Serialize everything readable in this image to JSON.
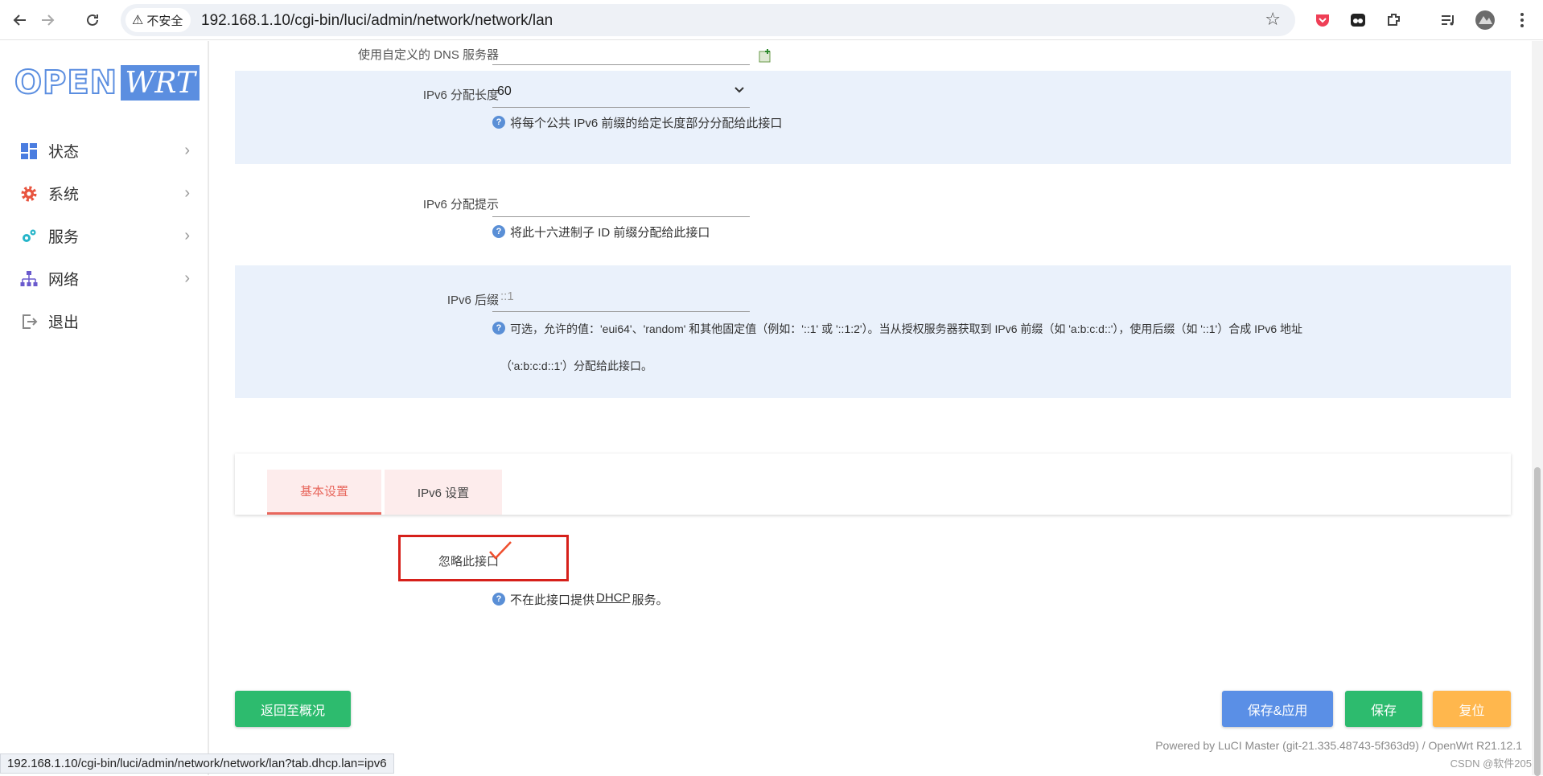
{
  "browser": {
    "security_label": "不安全",
    "url": "192.168.1.10/cgi-bin/luci/admin/network/network/lan",
    "status_url": "192.168.1.10/cgi-bin/luci/admin/network/network/lan?tab.dhcp.lan=ipv6"
  },
  "logo": {
    "open": "OPEN",
    "wrt": "WRT"
  },
  "sidebar": {
    "items": [
      {
        "label": "状态",
        "icon": "dashboard-icon"
      },
      {
        "label": "系统",
        "icon": "gear-icon"
      },
      {
        "label": "服务",
        "icon": "services-gears-icon"
      },
      {
        "label": "网络",
        "icon": "network-icon"
      },
      {
        "label": "退出",
        "icon": "logout-icon"
      }
    ]
  },
  "form": {
    "dns_label": "使用自定义的 DNS 服务器",
    "ipv6_assign_len": {
      "label": "IPv6 分配长度",
      "value": "60",
      "hint": "将每个公共 IPv6 前缀的给定长度部分分配给此接口"
    },
    "ipv6_hint": {
      "label": "IPv6 分配提示",
      "value": "",
      "hint": "将此十六进制子 ID 前缀分配给此接口"
    },
    "ipv6_suffix": {
      "label": "IPv6 后缀",
      "placeholder": "::1",
      "hint_line1": "可选，允许的值：'eui64'、'random' 和其他固定值（例如：'::1' 或 '::1:2'）。当从授权服务器获取到 IPv6 前缀（如 'a:b:c:d::'），使用后缀（如 '::1'）合成 IPv6 地址",
      "hint_line2": "（'a:b:c:d::1'）分配给此接口。"
    }
  },
  "tabs": [
    {
      "label": "基本设置",
      "active": true
    },
    {
      "label": "IPv6 设置",
      "active": false
    }
  ],
  "dhcp": {
    "ignore_label": "忽略此接口",
    "ignore_checked": true,
    "hint_prefix": "不在此接口提供 ",
    "hint_link": "DHCP",
    "hint_suffix": " 服务。"
  },
  "buttons": {
    "back": "返回至概况",
    "save_apply": "保存&应用",
    "save": "保存",
    "reset": "复位"
  },
  "footer": "Powered by LuCI Master (git-21.335.48743-5f363d9) / OpenWrt R21.12.1",
  "watermark": "CSDN @软件205",
  "colors": {
    "accent_blue": "#5a8fe6",
    "accent_green": "#2dbb6e",
    "accent_orange": "#ffb74d",
    "tab_active": "#e8675d",
    "highlight_red": "#d6201a"
  }
}
